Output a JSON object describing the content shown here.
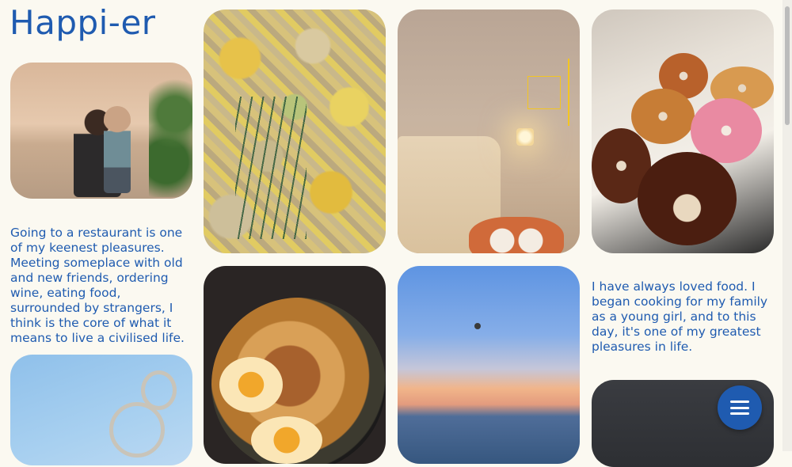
{
  "site": {
    "title": "Happi-er"
  },
  "paragraphs": {
    "restaurant": "Going to a restaurant is one of my keenest pleasures. Meeting someplace with old and new friends, ordering wine, eating food, surrounded by strangers, I think is the core of what it means to live a civilised life.",
    "cooking": "I have always loved food. I began cooking for my family as a young girl, and to this day, it's one of my greatest pleasures in life."
  },
  "photos": [
    {
      "id": "family",
      "icon": "photo-family"
    },
    {
      "id": "leaves",
      "icon": "photo-leaves"
    },
    {
      "id": "room",
      "icon": "photo-bedroom"
    },
    {
      "id": "donuts",
      "icon": "photo-donuts"
    },
    {
      "id": "noodles",
      "icon": "photo-noodles"
    },
    {
      "id": "sky",
      "icon": "photo-sunset-sea"
    },
    {
      "id": "keys",
      "icon": "photo-keys"
    },
    {
      "id": "dark",
      "icon": "photo-dark"
    }
  ],
  "fab": {
    "icon": "menu-icon"
  },
  "colors": {
    "accent": "#1f5bb0",
    "background": "#fbf9f1"
  }
}
